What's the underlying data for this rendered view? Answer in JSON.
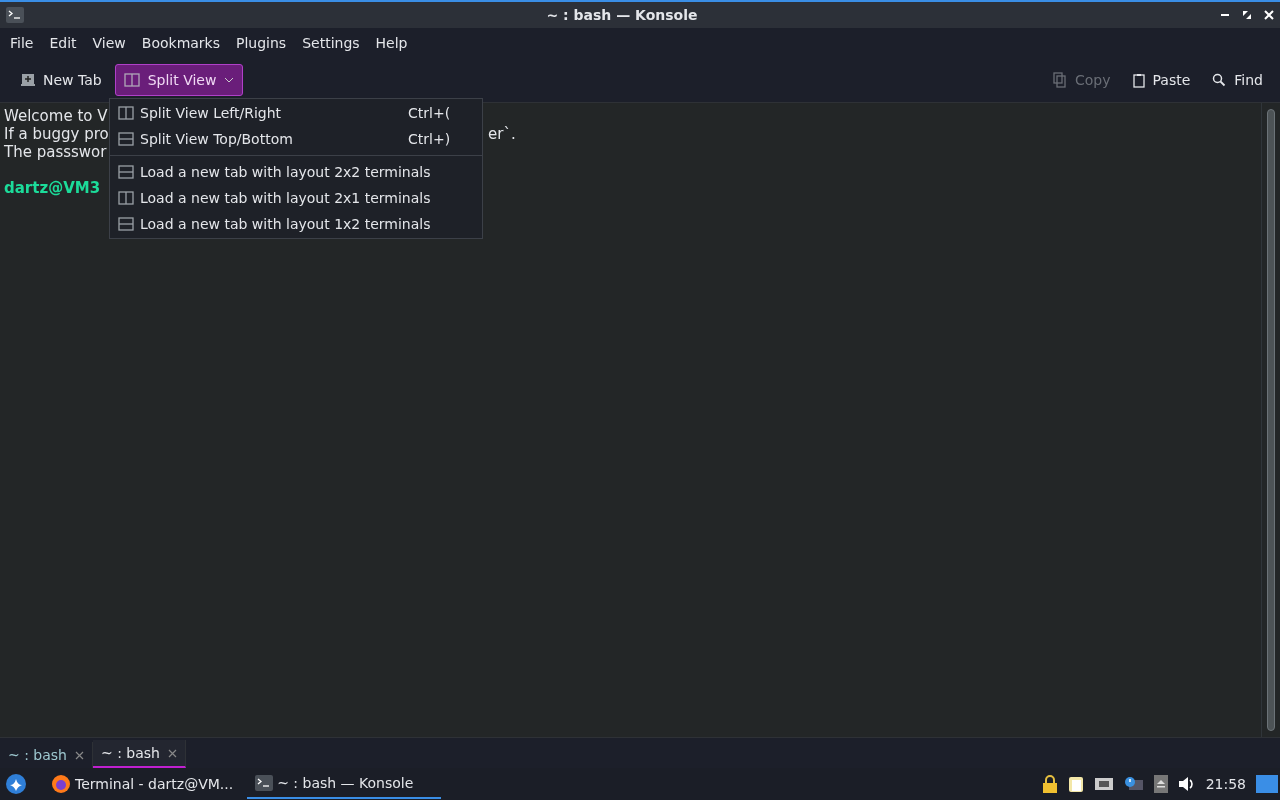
{
  "window": {
    "title": "~ : bash — Konsole"
  },
  "menu_bar": [
    "File",
    "Edit",
    "View",
    "Bookmarks",
    "Plugins",
    "Settings",
    "Help"
  ],
  "toolbar": {
    "left": [
      {
        "label": "New Tab",
        "kind": "newtab",
        "selected": false,
        "disabled": false
      },
      {
        "label": "Split View",
        "kind": "split",
        "selected": true,
        "disabled": false
      }
    ],
    "right": [
      {
        "label": "Copy",
        "kind": "copy",
        "selected": false,
        "disabled": true
      },
      {
        "label": "Paste",
        "kind": "paste",
        "selected": false,
        "disabled": false
      },
      {
        "label": "Find",
        "kind": "find",
        "selected": false,
        "disabled": false
      }
    ]
  },
  "split_menu": {
    "groups": [
      [
        {
          "label": "Split View Left/Right",
          "shortcut": "Ctrl+(",
          "kind": "vertical"
        },
        {
          "label": "Split View Top/Bottom",
          "shortcut": "Ctrl+)",
          "kind": "horizontal"
        }
      ],
      [
        {
          "label": "Load a new tab with layout 2x2 terminals",
          "kind": "horizontal"
        },
        {
          "label": "Load a new tab with layout 2x1 terminals",
          "kind": "vertical"
        },
        {
          "label": "Load a new tab with layout 1x2 terminals",
          "kind": "horizontal"
        }
      ]
    ]
  },
  "terminal": {
    "lines": [
      {
        "text": "Welcome to V",
        "kind": "plain"
      },
      {
        "text": "If a buggy pro",
        "tail": "er`.",
        "kind": "plain"
      },
      {
        "text": "The passswor",
        "kind": "plain"
      },
      {
        "kind": "blank"
      },
      {
        "text": "dartz@VM3",
        "kind": "prompt"
      }
    ]
  },
  "tabs": [
    {
      "label": "~ : bash",
      "selected": false
    },
    {
      "label": "~ : bash",
      "selected": true
    }
  ],
  "taskbar": {
    "tasks": [
      {
        "label": "Terminal - dartz@VM...",
        "kind": "firefox",
        "selected": false
      },
      {
        "label": "~ : bash — Konsole",
        "kind": "konsole",
        "selected": true
      }
    ],
    "clock": "21:58"
  }
}
